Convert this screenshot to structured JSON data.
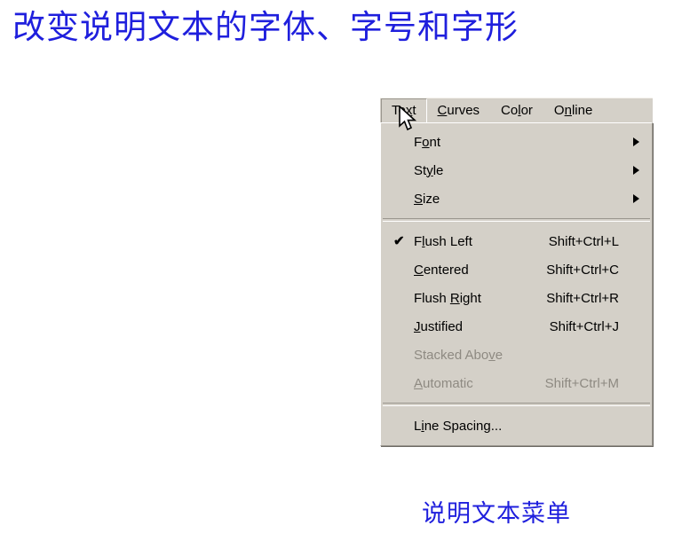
{
  "page": {
    "title": "改变说明文本的字体、字号和字形",
    "caption": "说明文本菜单",
    "title_color": "#1f1fdd",
    "menu_bg_color": "#d4d0c8",
    "menu_text_color": "#000000",
    "menu_disabled_color": "#8e8a82"
  },
  "menubar": {
    "items": [
      {
        "pre": "Te",
        "mnemonic": "x",
        "post": "t",
        "state": "open"
      },
      {
        "pre": "",
        "mnemonic": "C",
        "post": "urves",
        "state": "normal"
      },
      {
        "pre": "Co",
        "mnemonic": "l",
        "post": "or",
        "state": "normal"
      },
      {
        "pre": "O",
        "mnemonic": "n",
        "post": "line",
        "state": "normal"
      }
    ]
  },
  "dropdown": {
    "groups": [
      {
        "items": [
          {
            "pre": "F",
            "mnemonic": "o",
            "post": "nt",
            "accel": "",
            "checked": false,
            "submenu": true,
            "disabled": false
          },
          {
            "pre": "St",
            "mnemonic": "y",
            "post": "le",
            "accel": "",
            "checked": false,
            "submenu": true,
            "disabled": false
          },
          {
            "pre": "",
            "mnemonic": "S",
            "post": "ize",
            "accel": "",
            "checked": false,
            "submenu": true,
            "disabled": false
          }
        ]
      },
      {
        "items": [
          {
            "pre": "F",
            "mnemonic": "l",
            "post": "ush Left",
            "accel": "Shift+Ctrl+L",
            "checked": true,
            "submenu": false,
            "disabled": false
          },
          {
            "pre": "",
            "mnemonic": "C",
            "post": "entered",
            "accel": "Shift+Ctrl+C",
            "checked": false,
            "submenu": false,
            "disabled": false
          },
          {
            "pre": "Flush ",
            "mnemonic": "R",
            "post": "ight",
            "accel": "Shift+Ctrl+R",
            "checked": false,
            "submenu": false,
            "disabled": false
          },
          {
            "pre": "",
            "mnemonic": "J",
            "post": "ustified",
            "accel": "Shift+Ctrl+J",
            "checked": false,
            "submenu": false,
            "disabled": false
          },
          {
            "pre": "Stacked Abo",
            "mnemonic": "v",
            "post": "e",
            "accel": "",
            "checked": false,
            "submenu": false,
            "disabled": true
          },
          {
            "pre": "",
            "mnemonic": "A",
            "post": "utomatic",
            "accel": "Shift+Ctrl+M",
            "checked": false,
            "submenu": false,
            "disabled": true
          }
        ]
      },
      {
        "items": [
          {
            "pre": "L",
            "mnemonic": "i",
            "post": "ne Spacing...",
            "accel": "",
            "checked": false,
            "submenu": false,
            "disabled": false
          }
        ]
      }
    ],
    "check_glyph": "✔"
  },
  "cursor": {
    "icon": "mouse-pointer-icon"
  }
}
